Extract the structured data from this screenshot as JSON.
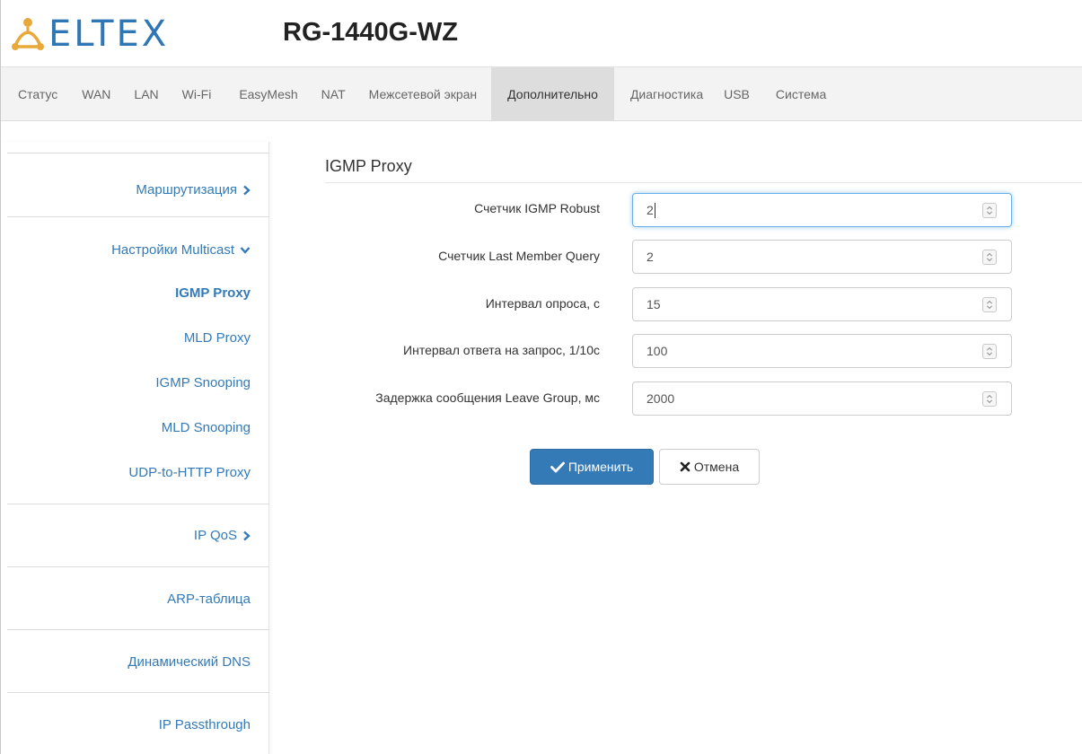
{
  "header": {
    "logo_text": "ELTEX",
    "model": "RG-1440G-WZ"
  },
  "topnav": {
    "items": [
      {
        "label": "Статус"
      },
      {
        "label": "WAN"
      },
      {
        "label": "LAN"
      },
      {
        "label": "Wi-Fi"
      },
      {
        "label": "EasyMesh"
      },
      {
        "label": "NAT"
      },
      {
        "label": "Межсетевой экран"
      },
      {
        "label": "Дополнительно",
        "active": true
      },
      {
        "label": "Диагностика"
      },
      {
        "label": "USB"
      },
      {
        "label": "Система"
      }
    ]
  },
  "sidebar": {
    "routing": "Маршрутизация",
    "multicast": "Настройки Multicast",
    "igmp_proxy": "IGMP Proxy",
    "mld_proxy": "MLD Proxy",
    "igmp_snooping": "IGMP Snooping",
    "mld_snooping": "MLD Snooping",
    "udp_http": "UDP-to-HTTP Proxy",
    "ip_qos": "IP QoS",
    "arp": "ARP-таблица",
    "ddns": "Динамический DNS",
    "ip_passthrough": "IP Passthrough"
  },
  "main": {
    "title": "IGMP Proxy",
    "fields": [
      {
        "label": "Счетчик IGMP Robust",
        "value": "2"
      },
      {
        "label": "Счетчик Last Member Query",
        "value": "2"
      },
      {
        "label": "Интервал опроса, с",
        "value": "15"
      },
      {
        "label": "Интервал ответа на запрос, 1/10с",
        "value": "100"
      },
      {
        "label": "Задержка сообщения Leave Group, мс",
        "value": "2000"
      }
    ],
    "apply_label": "Применить",
    "cancel_label": "Отмена"
  },
  "colors": {
    "accent": "#337ab7",
    "logo": "#2f76b5",
    "logo_icon": "#e8a83a",
    "active_tab": "#dddddd",
    "nav_bg": "#f3f3f3"
  }
}
